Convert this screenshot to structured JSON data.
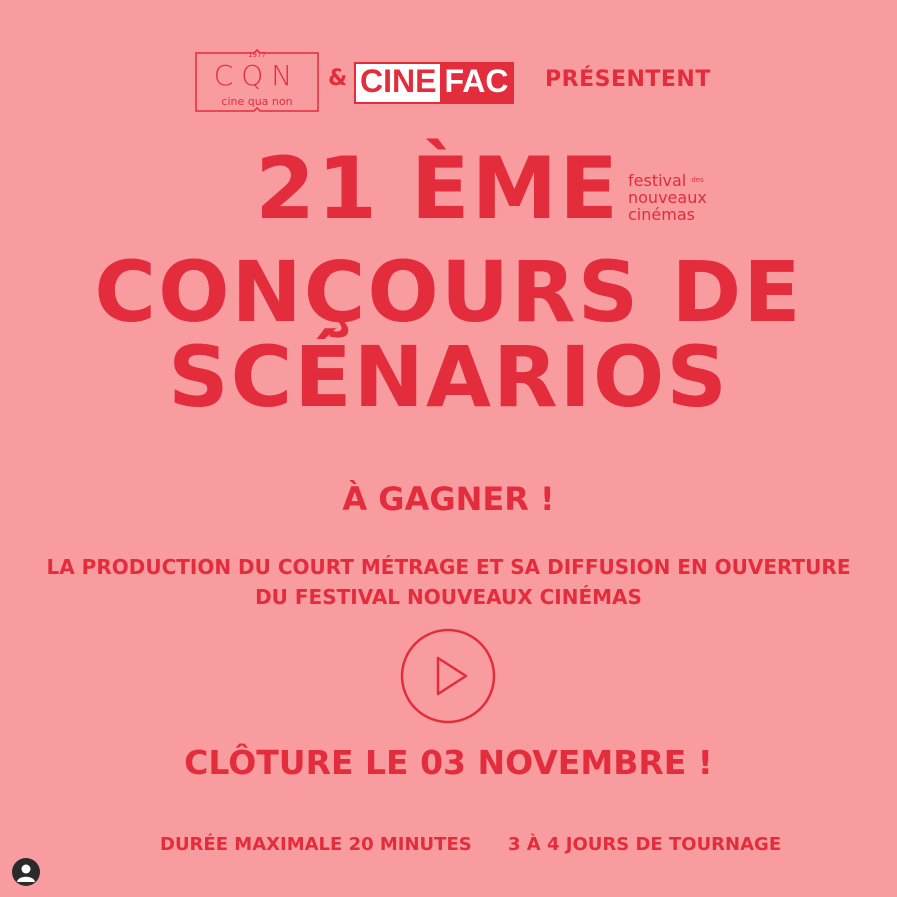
{
  "header": {
    "cqn_logo": {
      "year": "1977",
      "letters": "CQN",
      "subtitle": "cine qua non"
    },
    "ampersand": "&",
    "cinefac": {
      "part1": "CINE",
      "part2": "FAC"
    },
    "presenting": "PRÉSENTENT"
  },
  "title": {
    "line1": "21 ÈME",
    "line2": "CONÇOURS DE",
    "line3": "SCÉNARIOS"
  },
  "festival_logo": {
    "line1": "festival",
    "des": "des",
    "line2": "nouveaux",
    "line3": "cinémas"
  },
  "prize": {
    "heading": "À GAGNER !",
    "line1": "LA PRODUCTION DU COURT MÉTRAGE ET SA DIFFUSION EN OUVERTURE",
    "line2": "DU FESTIVAL NOUVEAUX CINÉMAS"
  },
  "play_icon": "play-icon",
  "deadline": "CLÔTURE LE 03 NOVEMBRE !",
  "details": {
    "duration": "DURÉE MAXIMALE 20 MINUTES",
    "shooting": "3 À 4 JOURS DE TOURNAGE"
  },
  "colors": {
    "background": "#f89c9f",
    "accent": "#e32c3c"
  }
}
